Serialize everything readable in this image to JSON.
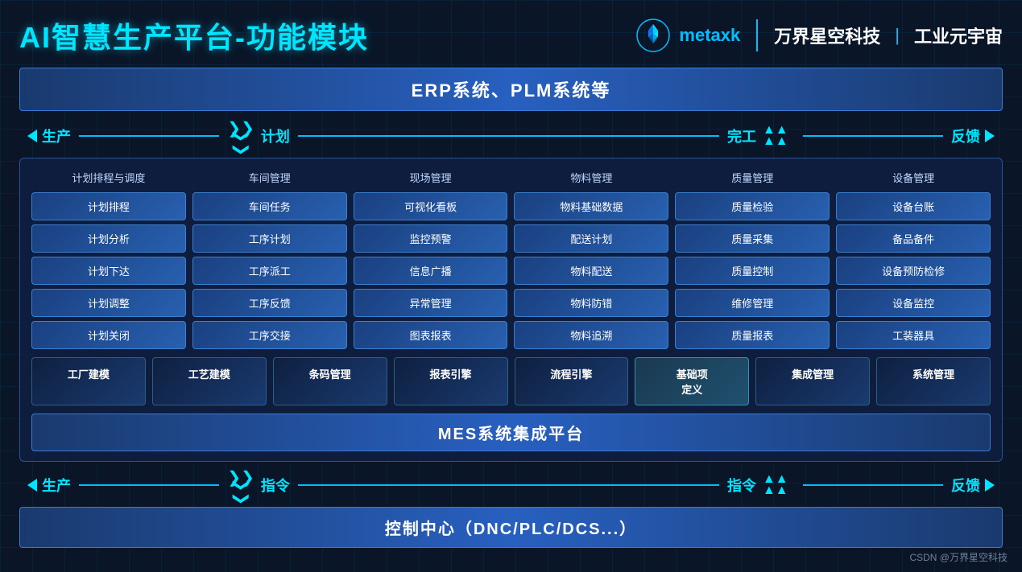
{
  "title": "AI智慧生产平台-功能模块",
  "brand": {
    "name": "metaxk",
    "sub_name": "万界星空科技",
    "divider": "|",
    "industry": "工业元宇宙"
  },
  "erp_bar": "ERP系统、PLM系统等",
  "flow1": {
    "left_label1": "生产",
    "left_label2": "计划",
    "right_label1": "完工",
    "right_label2": "反馈"
  },
  "columns": [
    {
      "header": "计划排程与调度",
      "items": [
        "计划排程",
        "计划分析",
        "计划下达",
        "计划调整",
        "计划关闭"
      ]
    },
    {
      "header": "车间管理",
      "items": [
        "车间任务",
        "工序计划",
        "工序派工",
        "工序反馈",
        "工序交接"
      ]
    },
    {
      "header": "现场管理",
      "items": [
        "可视化看板",
        "监控预警",
        "信息广播",
        "异常管理",
        "图表报表"
      ]
    },
    {
      "header": "物料管理",
      "items": [
        "物料基础数据",
        "配送计划",
        "物料配送",
        "物料防错",
        "物料追溯"
      ]
    },
    {
      "header": "质量管理",
      "items": [
        "质量检验",
        "质量采集",
        "质量控制",
        "维修管理",
        "质量报表"
      ]
    },
    {
      "header": "设备管理",
      "items": [
        "设备台账",
        "备品备件",
        "设备预防检修",
        "设备监控",
        "工装器具"
      ]
    }
  ],
  "bottom_modules": [
    "工厂建模",
    "工艺建模",
    "条码管理",
    "报表引擎",
    "流程引擎",
    "基础项\n定义",
    "集成管理",
    "系统管理"
  ],
  "mes_bar": "MES系统集成平台",
  "flow2": {
    "left_label1": "生产",
    "left_label2": "指令",
    "right_label1": "指令",
    "right_label2": "反馈"
  },
  "control_bar": "控制中心（DNC/PLC/DCS...）",
  "watermark": "CSDN @万界星空科技"
}
